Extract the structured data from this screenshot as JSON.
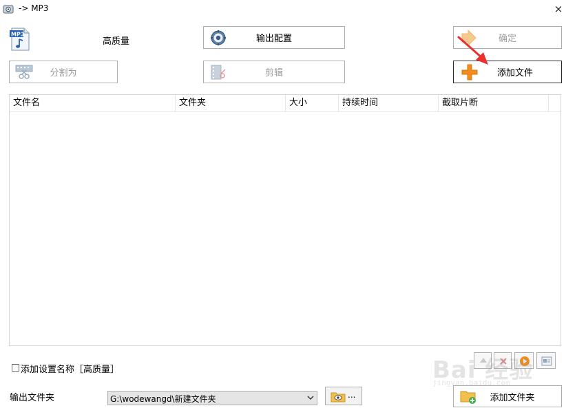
{
  "window": {
    "title": "-> MP3",
    "close_glyph": "×"
  },
  "top": {
    "format_icon": "mp3-file-icon",
    "format_icon_text": "MP3",
    "quality_label": "高质量",
    "output_config_label": "输出配置",
    "confirm_label": "确定",
    "split_label": "分割为",
    "edit_label": "剪辑",
    "add_file_label": "添加文件"
  },
  "list": {
    "columns": [
      "文件名",
      "文件夹",
      "大小",
      "持续时间",
      "截取片断"
    ],
    "rows": []
  },
  "bottom": {
    "add_setting_name_label": "添加设置名称［高质量］",
    "add_setting_name_checked": false,
    "output_folder_label": "输出文件夹",
    "output_folder_value": "G:\\wodewangd\\新建文件夹",
    "browse_label": "...",
    "add_folder_label": "添加文件夹"
  },
  "watermark": {
    "text": "Bai 经验",
    "sub": "jingyan.baidu.com"
  },
  "colors": {
    "accent_orange": "#f28c1e",
    "annotation_red": "#e8312f",
    "border": "#adadad"
  }
}
